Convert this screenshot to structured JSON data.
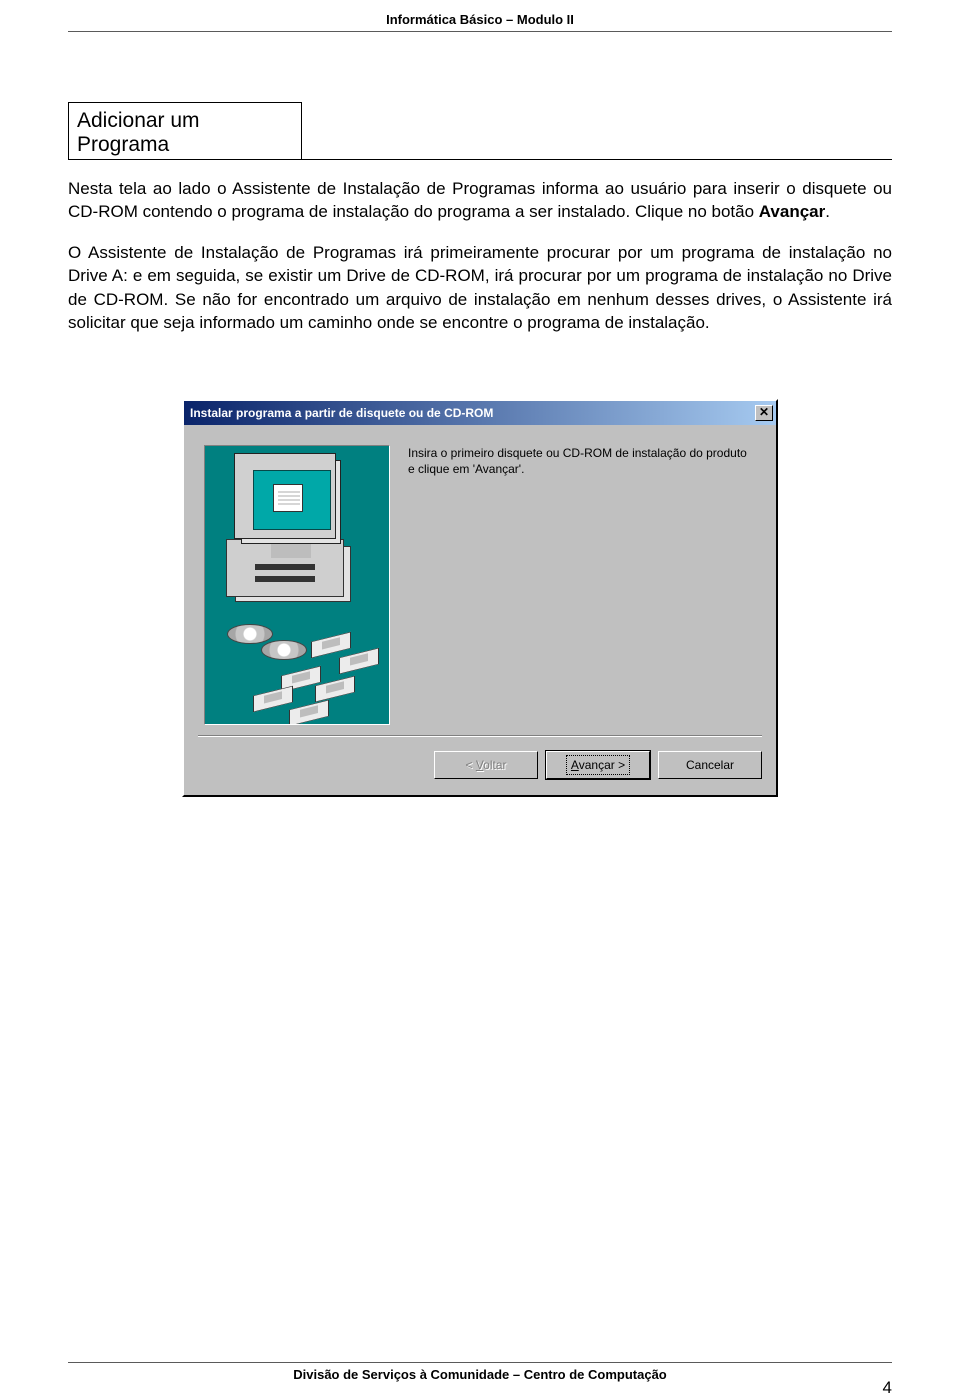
{
  "header": "Informática Básico – Modulo II",
  "section_title": "Adicionar um Programa",
  "body_p1a": "Nesta tela ao lado o Assistente de Instalação de Programas informa ao usuário para inserir o disquete ou CD-ROM contendo o programa de instalação do programa a ser instalado. Clique no botão ",
  "body_p1b": "Avançar",
  "body_p1c": ".",
  "body_p2": "O Assistente de Instalação de Programas irá primeiramente procurar por um programa de instalação no Drive A: e em seguida, se existir um Drive de CD-ROM, irá procurar por um programa de instalação no Drive de CD-ROM. Se não for encontrado um arquivo de instalação em nenhum desses drives, o Assistente irá solicitar que seja informado um caminho onde se encontre o programa de instalação.",
  "dialog": {
    "title": "Instalar programa a partir de disquete ou de CD-ROM",
    "close_glyph": "✕",
    "body_text": "Insira o primeiro disquete ou CD-ROM de instalação do produto e clique em 'Avançar'.",
    "btn_back_prefix": "< ",
    "btn_back_u": "V",
    "btn_back_rest": "oltar",
    "btn_next_u": "A",
    "btn_next_rest": "vançar >",
    "btn_cancel": "Cancelar"
  },
  "footer": "Divisão de Serviços à Comunidade – Centro de Computação",
  "page_number": "4"
}
